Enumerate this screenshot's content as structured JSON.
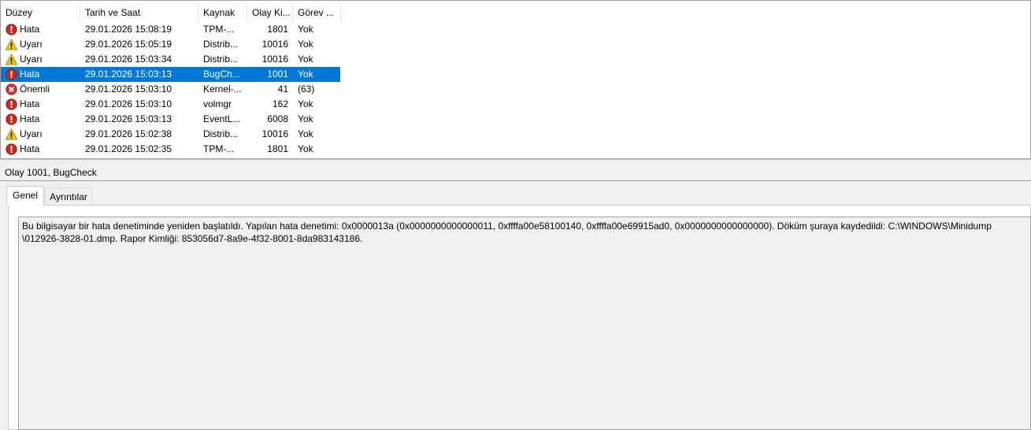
{
  "columns": [
    "Düzey",
    "Tarih ve Saat",
    "Kaynak",
    "Olay Ki...",
    "Görev ..."
  ],
  "rows": [
    {
      "level": "Hata",
      "icon": "error-icon",
      "date": "29.01.2026 15:08:19",
      "source": "TPM-...",
      "event_id": "1801",
      "task": "Yok",
      "selected": false
    },
    {
      "level": "Uyarı",
      "icon": "warning-icon",
      "date": "29.01.2026 15:05:19",
      "source": "Distrib...",
      "event_id": "10016",
      "task": "Yok",
      "selected": false
    },
    {
      "level": "Uyarı",
      "icon": "warning-icon",
      "date": "29.01.2026 15:03:34",
      "source": "Distrib...",
      "event_id": "10016",
      "task": "Yok",
      "selected": false
    },
    {
      "level": "Hata",
      "icon": "error-icon",
      "date": "29.01.2026 15:03:13",
      "source": "BugCh...",
      "event_id": "1001",
      "task": "Yok",
      "selected": true
    },
    {
      "level": "Önemli",
      "icon": "critical-icon",
      "date": "29.01.2026 15:03:10",
      "source": "Kernel-...",
      "event_id": "41",
      "task": "(63)",
      "selected": false
    },
    {
      "level": "Hata",
      "icon": "error-icon",
      "date": "29.01.2026 15:03:10",
      "source": "volmgr",
      "event_id": "162",
      "task": "Yok",
      "selected": false
    },
    {
      "level": "Hata",
      "icon": "error-icon",
      "date": "29.01.2026 15:03:13",
      "source": "EventL...",
      "event_id": "6008",
      "task": "Yok",
      "selected": false
    },
    {
      "level": "Uyarı",
      "icon": "warning-icon",
      "date": "29.01.2026 15:02:38",
      "source": "Distrib...",
      "event_id": "10016",
      "task": "Yok",
      "selected": false
    },
    {
      "level": "Hata",
      "icon": "error-icon",
      "date": "29.01.2026 15:02:35",
      "source": "TPM-...",
      "event_id": "1801",
      "task": "Yok",
      "selected": false
    }
  ],
  "detail": {
    "title": "Olay 1001, BugCheck",
    "tabs": [
      "Genel",
      "Ayrıntılar"
    ],
    "description_line1": "Bu bilgisayar bir hata denetiminde yeniden başlatıldı. Yapılan hata denetimi: 0x0000013a (0x0000000000000011, 0xffffa00e58100140, 0xffffa00e69915ad0, 0x0000000000000000). Döküm şuraya kaydedildi: C:\\WINDOWS\\Minidump",
    "description_line2": "\\012926-3828-01.dmp. Rapor Kimliği: 853056d7-8a9e-4f32-8001-8da983143186."
  },
  "colors": {
    "selection": "#0078d7",
    "error": "#c42b1c",
    "warning": "#f2c811",
    "critical": "#d13438"
  }
}
